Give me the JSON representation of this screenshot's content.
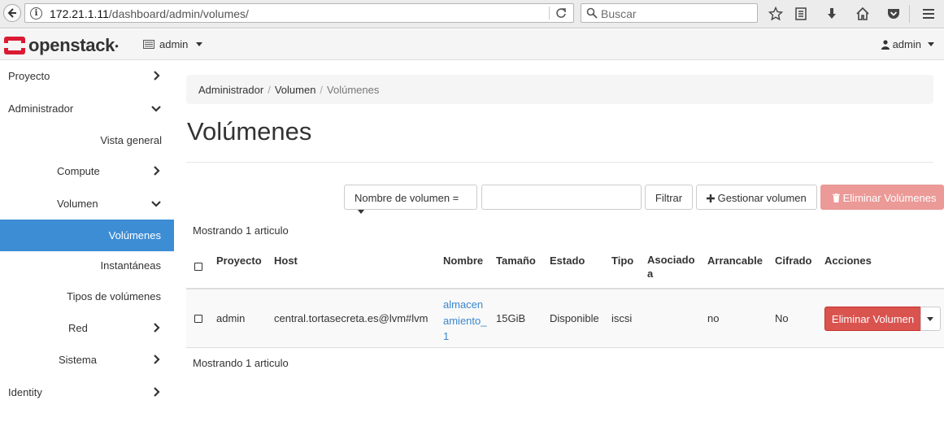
{
  "browser": {
    "url_host": "172.21.1.11",
    "url_path": "/dashboard/admin/volumes/",
    "search_placeholder": "Buscar"
  },
  "header": {
    "logo_text": "openstack",
    "project": "admin",
    "user": "admin"
  },
  "sidebar": {
    "items": [
      {
        "label": "Proyecto",
        "state": "collapsed"
      },
      {
        "label": "Administrador",
        "state": "expanded"
      },
      {
        "label": "Vista general"
      },
      {
        "label": "Compute",
        "state": "collapsed"
      },
      {
        "label": "Volumen",
        "state": "expanded"
      },
      {
        "label": "Volúmenes",
        "active": true
      },
      {
        "label": "Instantáneas"
      },
      {
        "label": "Tipos de volúmenes"
      },
      {
        "label": "Red",
        "state": "collapsed"
      },
      {
        "label": "Sistema",
        "state": "collapsed"
      },
      {
        "label": "Identity",
        "state": "collapsed"
      }
    ]
  },
  "breadcrumb": [
    "Administrador",
    "Volumen",
    "Volúmenes"
  ],
  "page_title": "Volúmenes",
  "toolbar": {
    "filter_field": "Nombre de volumen =",
    "filter_value": "",
    "filter_button": "Filtrar",
    "manage_button": "Gestionar volumen",
    "delete_all_button": "Eliminar Volúmenes"
  },
  "table": {
    "count_text": "Mostrando 1 articulo",
    "columns": [
      "Proyecto",
      "Host",
      "Nombre",
      "Tamaño",
      "Estado",
      "Tipo",
      "Asociado a",
      "Arrancable",
      "Cifrado",
      "Acciones"
    ],
    "rows": [
      {
        "proyecto": "admin",
        "host": "central.tortasecreta.es@lvm#lvm",
        "nombre": "almacenamiento_1",
        "tamano": "15GiB",
        "estado": "Disponible",
        "tipo": "iscsi",
        "asociado": "",
        "arrancable": "no",
        "cifrado": "No",
        "accion": "Eliminar Volumen"
      }
    ]
  },
  "colors": {
    "active_nav": "#3d8dd5",
    "danger": "#d9534f",
    "link": "#3a87ce",
    "logo_red": "#da1a32"
  }
}
